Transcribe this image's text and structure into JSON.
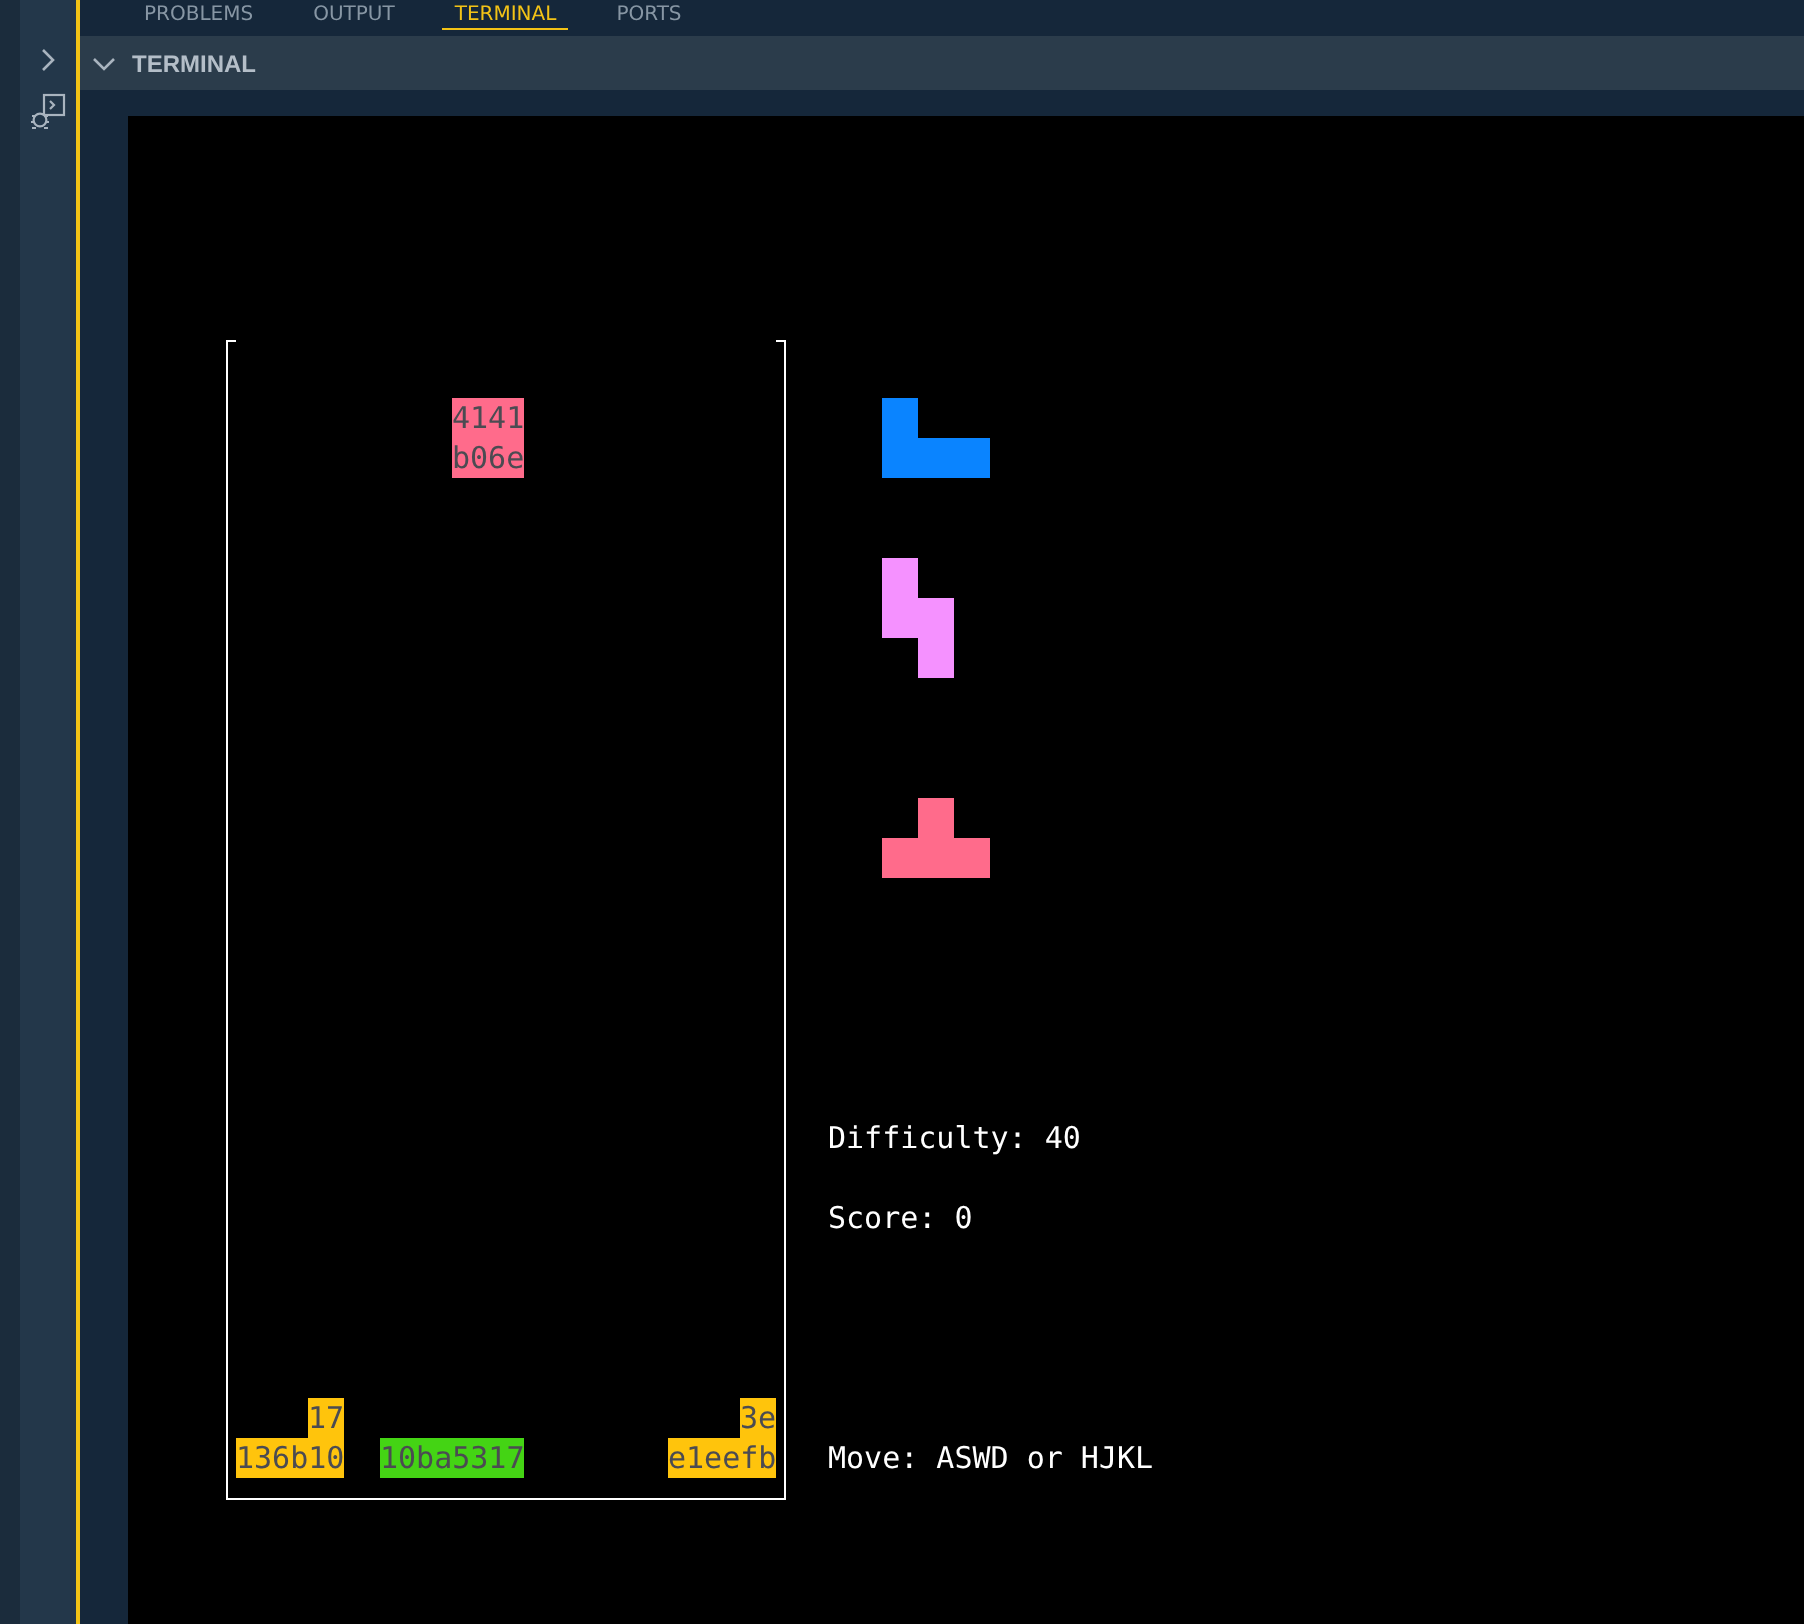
{
  "panel_tabs": [
    {
      "label": "PROBLEMS",
      "selected": false
    },
    {
      "label": "OUTPUT",
      "selected": false
    },
    {
      "label": "TERMINAL",
      "selected": true
    },
    {
      "label": "PORTS",
      "selected": false
    }
  ],
  "terminal": {
    "title": "TERMINAL",
    "expanded": true
  },
  "board": {
    "tiles": [
      {
        "text": "4141",
        "color": "#ff6b8b"
      },
      {
        "text": "b06e",
        "color": "#ff6b8b"
      },
      {
        "text": "17",
        "color": "#ffc40c"
      },
      {
        "text": "3e",
        "color": "#ffc40c"
      },
      {
        "text": "136b10",
        "color": "#ffc40c"
      },
      {
        "text": "10ba5317",
        "color": "#44d414"
      },
      {
        "text": "e1eefb",
        "color": "#ffc40c"
      }
    ]
  },
  "next_pieces": [
    {
      "kind": "L",
      "color": "#0a84ff"
    },
    {
      "kind": "S",
      "color": "#f591ff"
    },
    {
      "kind": "T",
      "color": "#ff6b8b"
    }
  ],
  "stats": {
    "difficulty": "Difficulty: 40",
    "score": "Score: 0",
    "help": "Move: ASWD or HJKL"
  }
}
